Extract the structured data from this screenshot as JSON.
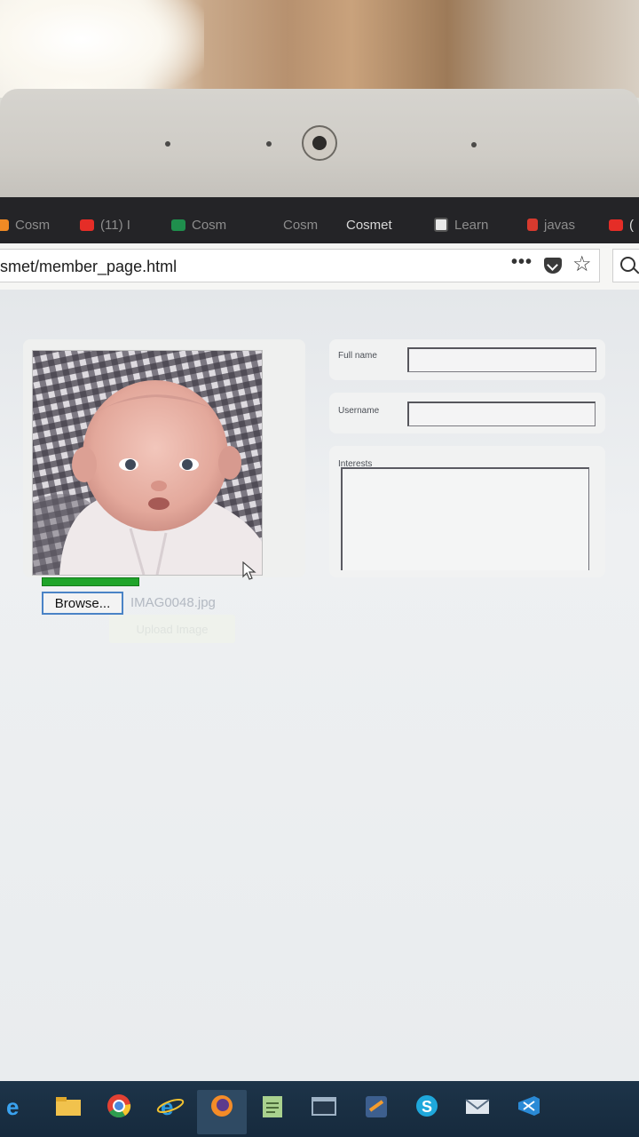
{
  "browser": {
    "tabs": [
      {
        "label": "Cosm",
        "icon": "orange-favicon-icon",
        "faded": true
      },
      {
        "label": "(11) I",
        "icon": "youtube-icon",
        "faded": true
      },
      {
        "label": "Cosm",
        "icon": "spreadsheet-icon",
        "faded": true
      },
      {
        "label": "Cosm",
        "icon": "",
        "faded": true
      },
      {
        "label": "Cosmet",
        "icon": "",
        "faded": false
      },
      {
        "label": "Learn",
        "icon": "learn-favicon-icon",
        "faded": true
      },
      {
        "label": "javas",
        "icon": "java-icon",
        "faded": true
      },
      {
        "label": "(",
        "icon": "youtube-icon",
        "faded": false
      }
    ],
    "url": "smet/member_page.html",
    "menu_dots": "•••",
    "bookmark_star": "☆"
  },
  "profile": {
    "photo_alt": "baby photo",
    "upload_progress": 1.0,
    "browse_label": "Browse...",
    "selected_file": "IMAG0048.jpg",
    "upload_label": "Upload Image"
  },
  "form": {
    "full_name": {
      "label": "Full name",
      "value": ""
    },
    "username": {
      "label": "Username",
      "value": ""
    },
    "interests": {
      "label": "Interests",
      "value": ""
    }
  },
  "taskbar": {
    "apps": [
      "edge-legacy-icon",
      "file-explorer-icon",
      "chrome-icon",
      "internet-explorer-icon",
      "firefox-icon",
      "notepad-icon",
      "window-icon",
      "sublime-icon",
      "skype-icon",
      "mail-icon",
      "visual-studio-icon"
    ]
  },
  "colors": {
    "tab_bar": "#242427",
    "progress_green": "#1fa42a",
    "browse_border": "#4a83c6",
    "taskbar": "#1d3449"
  }
}
